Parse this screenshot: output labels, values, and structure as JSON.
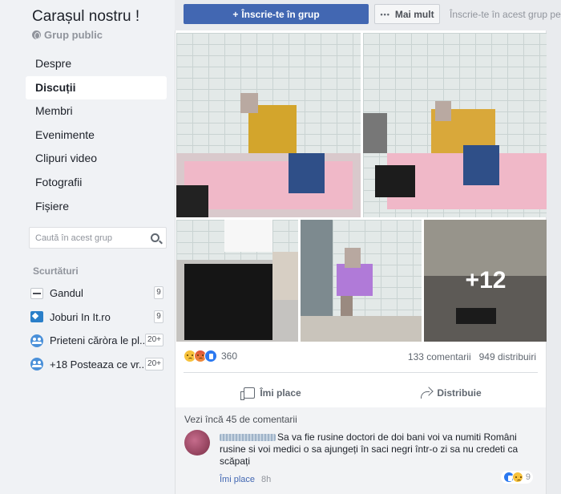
{
  "group": {
    "title": "Carașul nostru !",
    "type": "Grup public"
  },
  "nav": {
    "items": [
      {
        "label": "Despre"
      },
      {
        "label": "Discuții"
      },
      {
        "label": "Membri"
      },
      {
        "label": "Evenimente"
      },
      {
        "label": "Clipuri video"
      },
      {
        "label": "Fotografii"
      },
      {
        "label": "Fișiere"
      }
    ],
    "active": "Discuții"
  },
  "search": {
    "placeholder": "Caută în acest grup"
  },
  "shortcuts": {
    "title": "Scurtături",
    "items": [
      {
        "label": "Gandul",
        "badge": "9",
        "icon": "gandul-icon"
      },
      {
        "label": "Joburi In It.ro",
        "badge": "9",
        "icon": "joburi-icon"
      },
      {
        "label": "Prieteni căròra le pl...",
        "badge": "20+",
        "icon": "group-icon"
      },
      {
        "label": "+18 Posteaza ce vr...",
        "badge": "20+",
        "icon": "group-icon"
      }
    ]
  },
  "topbar": {
    "join_label": "Înscrie-te în grup",
    "join_icon": "+",
    "more_label": "Mai mult",
    "group_search_placeholder": "Înscrie-te în acest grup pentru a"
  },
  "post": {
    "photos_more": "+12",
    "reactions_count": "360",
    "comments_count": "133 comentarii",
    "shares_count": "949 distribuiri",
    "like_label": "Îmi place",
    "share_label": "Distribuie",
    "view_more_comments": "Vezi încă 45 de comentarii",
    "comment": {
      "text": "Sa va fie rusine doctori de doi bani voi va numiti Români rusine si voi medici o sa ajungeți în saci negri într-o zi sa nu credeti ca scăpați",
      "like_link": "Îmi place",
      "time": "8h",
      "reactions": "9"
    }
  },
  "colors": {
    "primary": "#4267b2",
    "background": "#e9ebee",
    "sidebar": "#f0f2f5"
  }
}
